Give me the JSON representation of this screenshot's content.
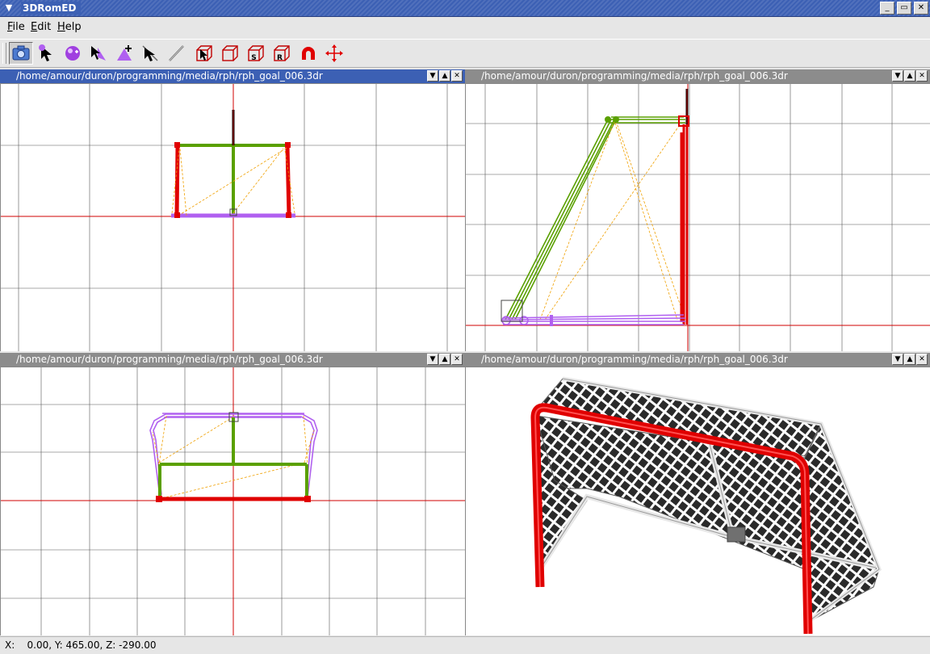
{
  "window": {
    "title": "3DRomED",
    "menu_icon": "chevron-down-icon",
    "controls": [
      "minimize-icon",
      "maximize-icon",
      "close-icon"
    ]
  },
  "menubar": {
    "items": [
      {
        "label": "File",
        "mnemonic": "F",
        "rest": "ile"
      },
      {
        "label": "Edit",
        "mnemonic": "E",
        "rest": "dit"
      },
      {
        "label": "Help",
        "mnemonic": "H",
        "rest": "elp"
      }
    ]
  },
  "toolbar": {
    "tools": [
      {
        "icon": "camera-icon",
        "active": true
      },
      {
        "icon": "select-arrow-icon"
      },
      {
        "icon": "sphere-icon"
      },
      {
        "icon": "pointer-add-icon"
      },
      {
        "icon": "add-vertex-icon"
      },
      {
        "icon": "pick-arrow-icon"
      },
      {
        "icon": "line-icon"
      },
      {
        "icon": "box-select-icon"
      },
      {
        "icon": "box-icon"
      },
      {
        "icon": "box-scale-icon",
        "letter": "S"
      },
      {
        "icon": "box-rotate-icon",
        "letter": "R"
      },
      {
        "icon": "magnet-icon"
      },
      {
        "icon": "move-arrows-icon"
      }
    ]
  },
  "viewports": [
    {
      "title": "/home/amour/duron/programming/media/rph/rph_goal_006.3dr",
      "active": true
    },
    {
      "title": "/home/amour/duron/programming/media/rph/rph_goal_006.3dr",
      "active": false
    },
    {
      "title": "/home/amour/duron/programming/media/rph/rph_goal_006.3dr",
      "active": false
    },
    {
      "title": "/home/amour/duron/programming/media/rph/rph_goal_006.3dr",
      "active": false
    }
  ],
  "viewport_buttons": {
    "down": "▼",
    "up": "▲",
    "close": "✕"
  },
  "colors": {
    "post_red": "#e00000",
    "frame_green": "#5aa000",
    "base_purple": "#b060f0",
    "guide_orange": "#f0a000",
    "axis_red": "#d00000",
    "grid": "#555555",
    "title_active": "#3c60b4",
    "title_inactive": "#8c8c8c"
  },
  "status": {
    "text": "X:    0.00, Y: 465.00, Z: -290.00"
  }
}
